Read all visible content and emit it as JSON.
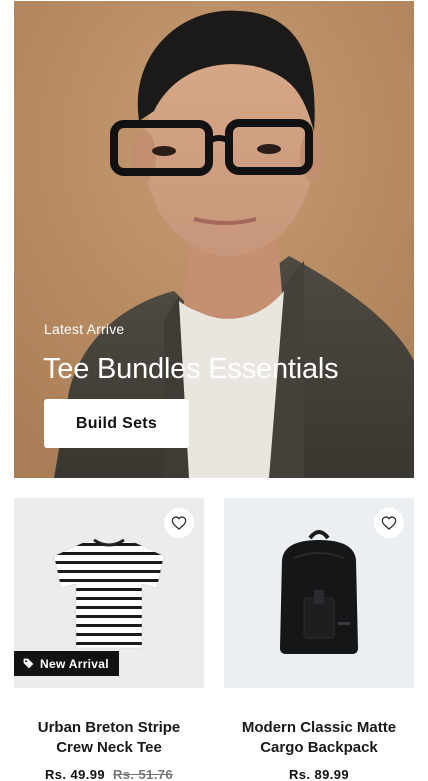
{
  "hero": {
    "eyebrow": "Latest Arrive",
    "title": "Tee Bundles Essentials",
    "cta_label": "Build Sets"
  },
  "products": [
    {
      "title": "Urban Breton Stripe Crew Neck Tee",
      "badge": "New Arrival",
      "price": "Rs. 49.99",
      "compare_price": "Rs. 51.76",
      "image_icon": "striped-tshirt-image"
    },
    {
      "title": "Modern Classic Matte Cargo Backpack",
      "badge": "",
      "price": "Rs. 89.99",
      "compare_price": "",
      "image_icon": "black-backpack-image"
    }
  ],
  "colors": {
    "hero_background": "#b98d64",
    "cta_background": "#ffffff",
    "badge_background": "#121212",
    "card_background": "#ececec"
  }
}
